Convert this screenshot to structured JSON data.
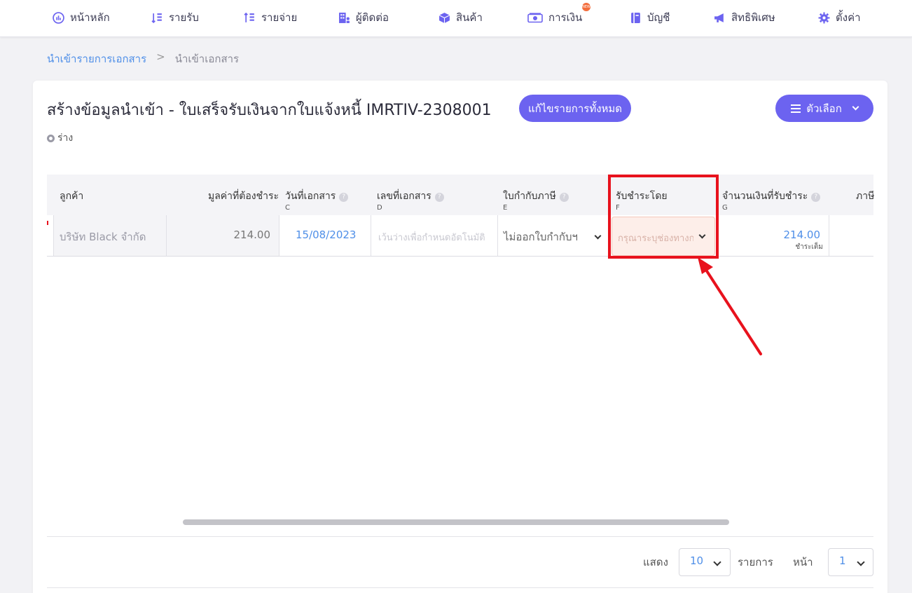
{
  "nav": {
    "items": [
      {
        "label": "หน้าหลัก",
        "icon": "dashboard-icon"
      },
      {
        "label": "รายรับ",
        "icon": "income-icon"
      },
      {
        "label": "รายจ่าย",
        "icon": "expense-icon"
      },
      {
        "label": "ผู้ติดต่อ",
        "icon": "contacts-icon"
      },
      {
        "label": "สินค้า",
        "icon": "box-icon"
      },
      {
        "label": "การเงิน",
        "icon": "money-icon",
        "badge": "NEW"
      },
      {
        "label": "บัญชี",
        "icon": "ledger-icon"
      },
      {
        "label": "สิทธิพิเศษ",
        "icon": "megaphone-icon"
      },
      {
        "label": "ตั้งค่า",
        "icon": "gear-icon"
      }
    ]
  },
  "breadcrumb": {
    "parent": "นำเข้ารายการเอกสาร",
    "separator": ">",
    "current": "นำเข้าเอกสาร"
  },
  "page": {
    "title": "สร้างข้อมูลนำเข้า - ใบเสร็จรับเงินจากใบแจ้งหนี้ IMRTIV-2308001",
    "edit_all_label": "แก้ไขรายการทั้งหมด",
    "options_label": "ตัวเลือก",
    "status": "ร่าง"
  },
  "table": {
    "columns": [
      {
        "label": "ลูกค้า",
        "letter": ""
      },
      {
        "label": "มูลค่าที่ต้องชำระ",
        "letter": ""
      },
      {
        "label": "วันที่เอกสาร",
        "letter": "C"
      },
      {
        "label": "เลขที่เอกสาร",
        "letter": "D"
      },
      {
        "label": "ใบกำกับภาษี",
        "letter": "E"
      },
      {
        "label": "รับชำระโดย",
        "letter": "F"
      },
      {
        "label": "จำนวนเงินที่รับชำระ",
        "letter": "G"
      },
      {
        "label": "ภาษี",
        "letter": ""
      }
    ],
    "row": {
      "customer": "บริษัท Black จำกัด",
      "amount_due": "214.00",
      "doc_date": "15/08/2023",
      "doc_no_placeholder": "เว้นว่างเพื่อกำหนดอัตโนมัติ",
      "tax_invoice": "ไม่ออกใบกำกับฯ",
      "payment_method_placeholder": "กรุณาระบุช่องทางการ",
      "paid_amount": "214.00",
      "paid_status": "ชำระเต็ม"
    }
  },
  "pagination": {
    "show_label": "แสดง",
    "page_size": "10",
    "items_label": "รายการ",
    "page_label": "หน้า",
    "page_number": "1"
  },
  "colors": {
    "accent": "#6c63f0",
    "link": "#4f8fe8",
    "highlight": "#e8121d",
    "invalid_bg": "#fdeee9"
  }
}
